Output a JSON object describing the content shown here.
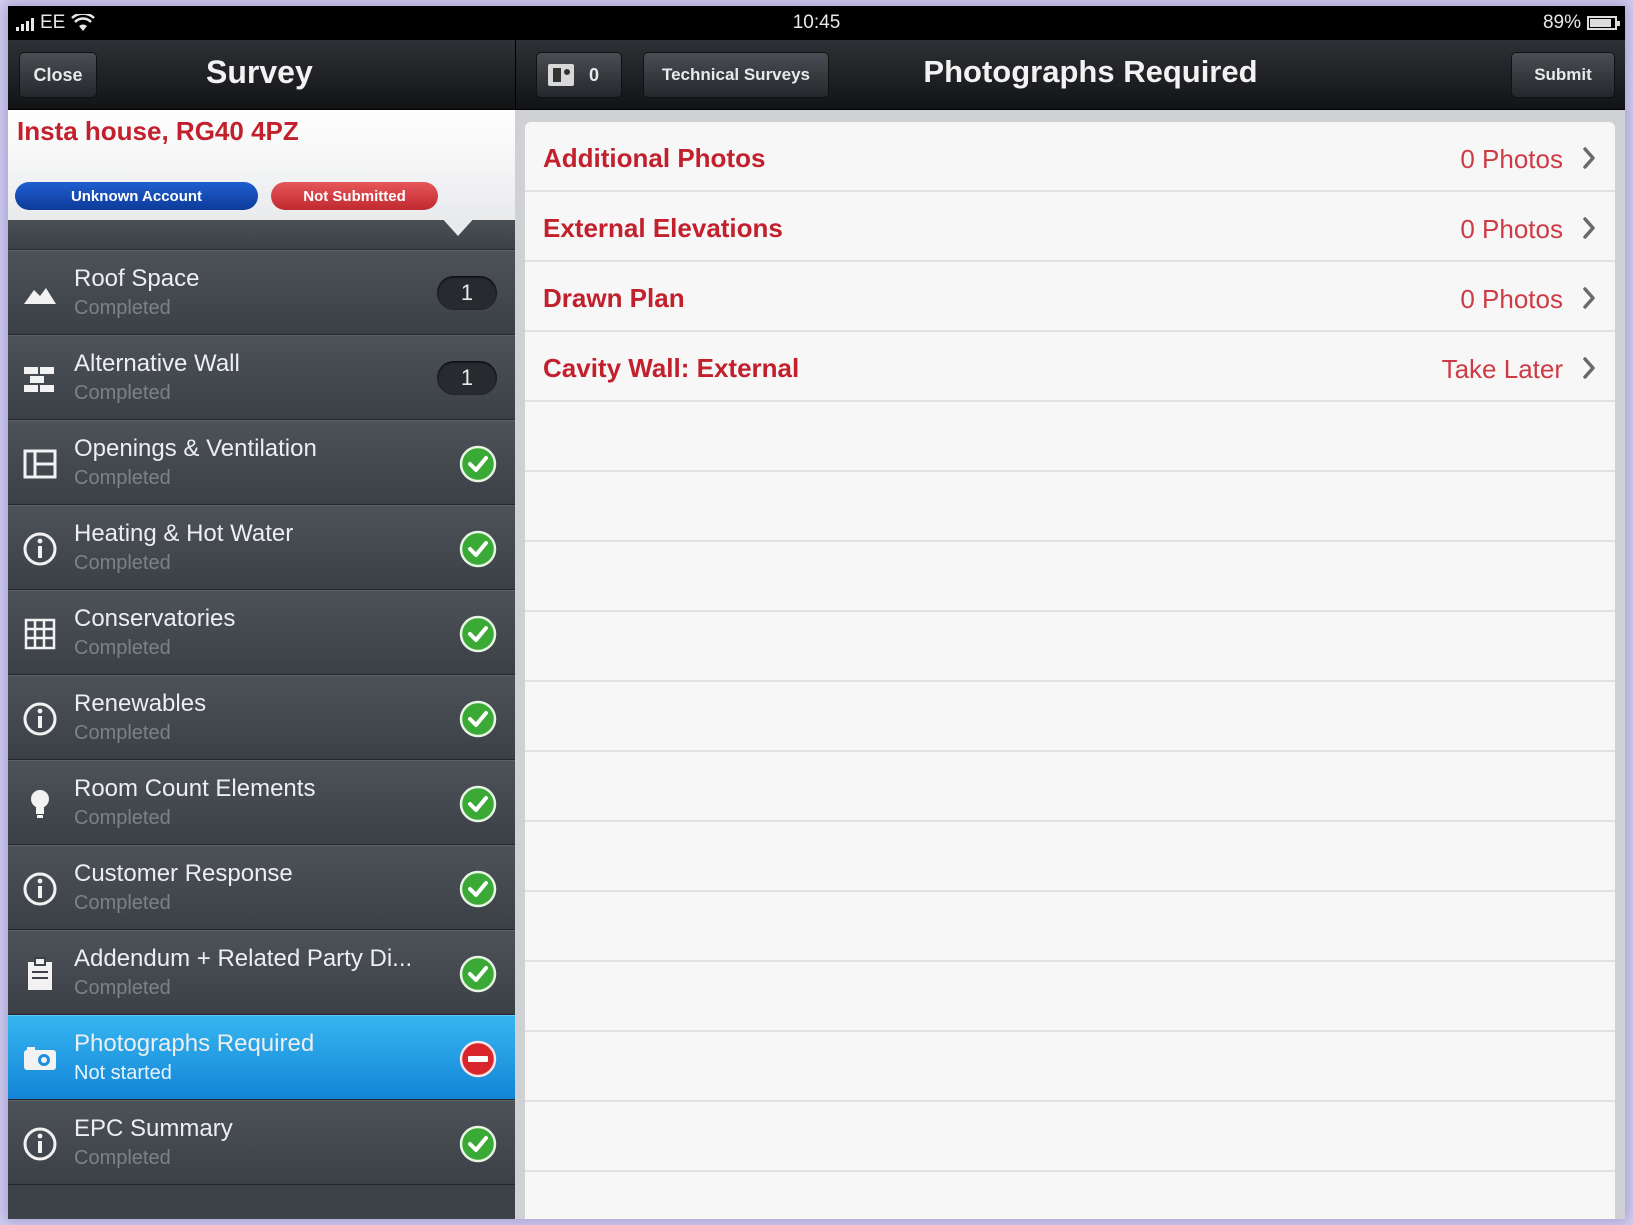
{
  "status_bar": {
    "carrier": "EE",
    "time": "10:45",
    "battery": "89%"
  },
  "left_nav": {
    "close_label": "Close",
    "title": "Survey"
  },
  "survey": {
    "address": "Insta house, RG40 4PZ",
    "account_badge": "Unknown Account",
    "submission_badge": "Not Submitted"
  },
  "sections": [
    {
      "title": "Roof Space",
      "status": "Completed",
      "icon": "roof-icon",
      "count": "1",
      "state": "count"
    },
    {
      "title": "Alternative Wall",
      "status": "Completed",
      "icon": "brick-wall-icon",
      "count": "1",
      "state": "count"
    },
    {
      "title": "Openings & Ventilation",
      "status": "Completed",
      "icon": "window-icon",
      "state": "done"
    },
    {
      "title": "Heating & Hot Water",
      "status": "Completed",
      "icon": "info-icon",
      "state": "done"
    },
    {
      "title": "Conservatories",
      "status": "Completed",
      "icon": "conservatory-icon",
      "state": "done"
    },
    {
      "title": "Renewables",
      "status": "Completed",
      "icon": "info-icon",
      "state": "done"
    },
    {
      "title": "Room Count Elements",
      "status": "Completed",
      "icon": "lightbulb-icon",
      "state": "done"
    },
    {
      "title": "Customer Response",
      "status": "Completed",
      "icon": "info-icon",
      "state": "done"
    },
    {
      "title": "Addendum + Related Party Di...",
      "status": "Completed",
      "icon": "clipboard-icon",
      "state": "done"
    },
    {
      "title": "Photographs Required",
      "status": "Not started",
      "icon": "camera-icon",
      "state": "blocked",
      "active": true
    },
    {
      "title": "EPC Summary",
      "status": "Completed",
      "icon": "info-icon",
      "state": "done"
    }
  ],
  "right_nav": {
    "photo_count": "0",
    "back_label": "Technical Surveys",
    "title": "Photographs Required",
    "submit_label": "Submit"
  },
  "photo_items": [
    {
      "label": "Additional Photos",
      "value": "0 Photos"
    },
    {
      "label": "External Elevations",
      "value": "0 Photos"
    },
    {
      "label": "Drawn Plan",
      "value": "0 Photos"
    },
    {
      "label": "Cavity Wall: External",
      "value": "Take Later"
    }
  ],
  "colors": {
    "accent_red": "#c2202c",
    "active_blue": "#1f9be2",
    "done_green": "#3aa935"
  }
}
